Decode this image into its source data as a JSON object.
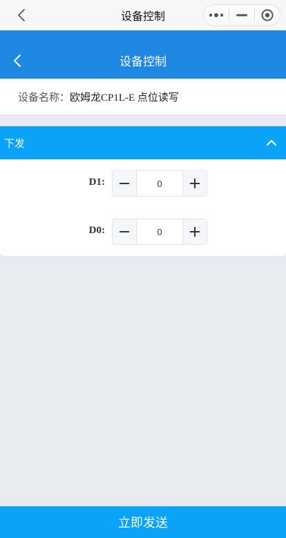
{
  "system_nav": {
    "title": "设备控制",
    "back_icon": "chevron-left-icon",
    "capsule": [
      "more-dots-icon",
      "minimize-icon",
      "close-target-icon"
    ]
  },
  "header": {
    "title": "设备控制",
    "background": "#1e86e3",
    "back_icon": "chevron-left-icon"
  },
  "device": {
    "label": "设备名称：",
    "name": "欧姆龙CP1L-E 点位读写"
  },
  "panel": {
    "title": "下发",
    "expanded": true,
    "accent": "#0ba2f9",
    "controls": [
      {
        "label": "D1:",
        "value": "0"
      },
      {
        "label": "D0:",
        "value": "0"
      }
    ]
  },
  "action": {
    "send_label": "立即发送"
  }
}
